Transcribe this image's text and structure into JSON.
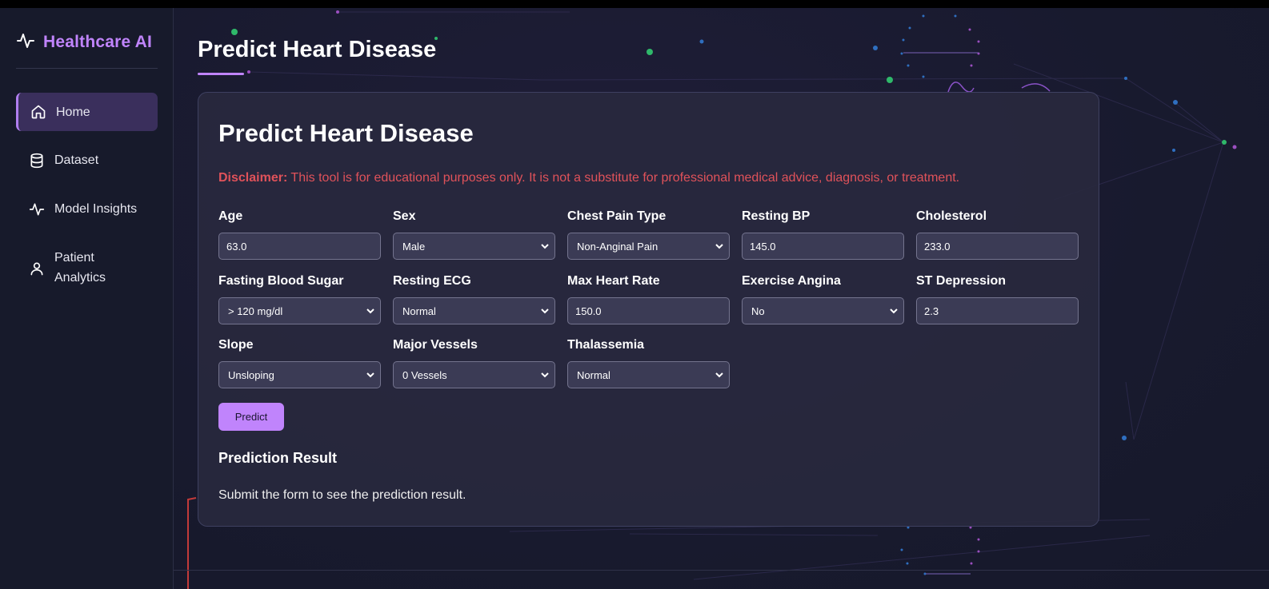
{
  "sidebar": {
    "brand": "Healthcare AI",
    "brand_icon": "activity-icon",
    "items": [
      {
        "label": "Home",
        "icon": "home-icon",
        "active": true
      },
      {
        "label": "Dataset",
        "icon": "database-icon",
        "active": false
      },
      {
        "label": "Model Insights",
        "icon": "activity-icon",
        "active": false
      },
      {
        "label": "Patient Analytics",
        "icon": "user-icon",
        "active": false
      }
    ]
  },
  "page": {
    "title": "Predict Heart Disease"
  },
  "card": {
    "title": "Predict Heart Disease",
    "disclaimer_label": "Disclaimer:",
    "disclaimer_text": " This tool is for educational purposes only. It is not a substitute for professional medical advice, diagnosis, or treatment.",
    "fields": [
      {
        "label": "Age",
        "value": "63.0",
        "type": "input"
      },
      {
        "label": "Sex",
        "value": "Male",
        "type": "select"
      },
      {
        "label": "Chest Pain Type",
        "value": "Non-Anginal Pain",
        "type": "select"
      },
      {
        "label": "Resting BP",
        "value": "145.0",
        "type": "input"
      },
      {
        "label": "Cholesterol",
        "value": "233.0",
        "type": "input"
      },
      {
        "label": "Fasting Blood Sugar",
        "value": "> 120 mg/dl",
        "type": "select"
      },
      {
        "label": "Resting ECG",
        "value": "Normal",
        "type": "select"
      },
      {
        "label": "Max Heart Rate",
        "value": "150.0",
        "type": "input"
      },
      {
        "label": "Exercise Angina",
        "value": "No",
        "type": "select"
      },
      {
        "label": "ST Depression",
        "value": "2.3",
        "type": "input"
      },
      {
        "label": "Slope",
        "value": "Unsloping",
        "type": "select"
      },
      {
        "label": "Major Vessels",
        "value": "0 Vessels",
        "type": "select"
      },
      {
        "label": "Thalassemia",
        "value": "Normal",
        "type": "select"
      }
    ],
    "predict_label": "Predict",
    "result_title": "Prediction Result",
    "result_text": "Submit the form to see the prediction result."
  },
  "colors": {
    "accent": "#c084fc",
    "disclaimer": "#e0525a",
    "background": "#181a2e"
  }
}
